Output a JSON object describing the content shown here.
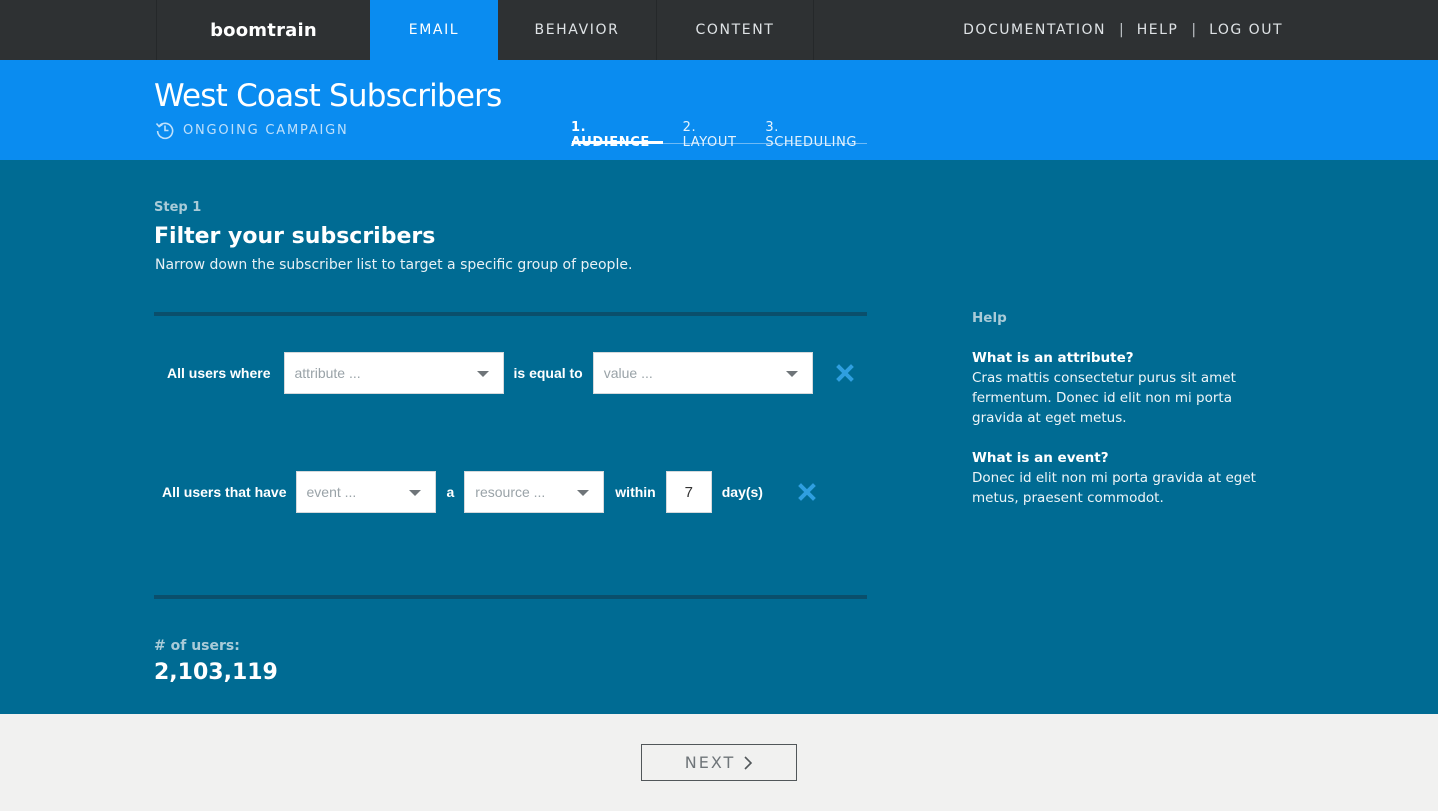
{
  "nav": {
    "brand": "boomtrain",
    "tabs": [
      "EMAIL",
      "BEHAVIOR",
      "CONTENT"
    ],
    "active_tab": "EMAIL",
    "links": [
      "DOCUMENTATION",
      "HELP",
      "LOG OUT"
    ],
    "separator": "|"
  },
  "header": {
    "title": "West Coast Subscribers",
    "campaign_type": "ONGOING CAMPAIGN",
    "campaign_icon": "history-icon",
    "steps": [
      "1. AUDIENCE",
      "2. LAYOUT",
      "3. SCHEDULING"
    ],
    "active_step": "1. AUDIENCE"
  },
  "main": {
    "step_label": "Step 1",
    "title": "Filter your subscribers",
    "description": "Narrow down the subscriber list to target a specific group of people.",
    "filters": {
      "attribute_row": {
        "prefix": "All users where",
        "attribute_placeholder": "attribute ...",
        "operator": "is equal to",
        "value_placeholder": "value ..."
      },
      "event_row": {
        "prefix": "All users that have",
        "event_placeholder": "event ...",
        "connector": "a",
        "resource_placeholder": "resource ...",
        "within_label": "within",
        "days_value": "7",
        "unit": "day(s)"
      }
    },
    "users_label": "# of users:",
    "users_count": "2,103,119"
  },
  "help": {
    "title": "Help",
    "items": [
      {
        "question": "What is an attribute?",
        "answer": "Cras mattis consectetur purus sit amet fermentum. Donec id elit non mi porta gravida at eget metus."
      },
      {
        "question": "What is an event?",
        "answer": "Donec id elit non mi porta gravida at eget metus, praesent commodot."
      }
    ]
  },
  "footer": {
    "next_label": "NEXT"
  },
  "colors": {
    "topnav_bg": "#2e3133",
    "accent_blue": "#0a8cf0",
    "main_teal": "#006b93",
    "remove_x": "#2f9fe0",
    "footer_bg": "#f1f1f0"
  }
}
